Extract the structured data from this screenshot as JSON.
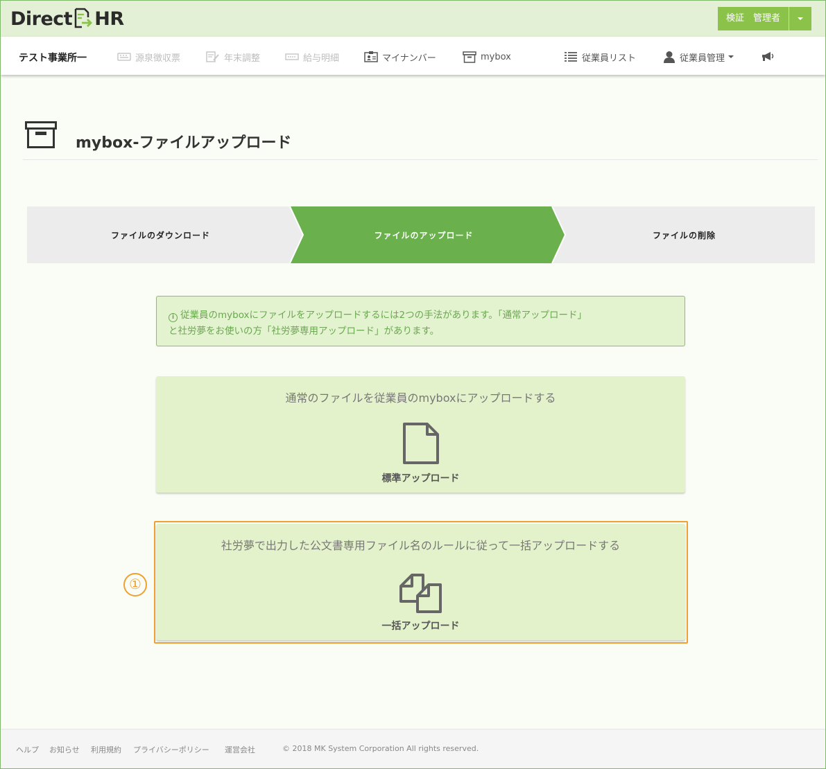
{
  "brand": {
    "name_left": "Direct",
    "name_right": "HR",
    "accent": "#8bc34a"
  },
  "user_menu": {
    "label": "検証　管理者"
  },
  "nav": {
    "office": "テスト事業所一",
    "items": [
      {
        "label": "源泉徴収票",
        "icon": "keyboard-icon",
        "enabled": false
      },
      {
        "label": "年末調整",
        "icon": "edit-document-icon",
        "enabled": false
      },
      {
        "label": "給与明細",
        "icon": "ticket-icon",
        "enabled": false
      },
      {
        "label": "マイナンバー",
        "icon": "id-card-icon",
        "enabled": true
      },
      {
        "label": "mybox",
        "icon": "archive-box-icon",
        "enabled": true
      },
      {
        "label": "従業員リスト",
        "icon": "list-icon",
        "enabled": true
      },
      {
        "label": "従業員管理",
        "icon": "user-icon",
        "enabled": true
      },
      {
        "label": "",
        "icon": "megaphone-icon",
        "enabled": true
      }
    ]
  },
  "page": {
    "title": "mybox-ファイルアップロード"
  },
  "steps": [
    {
      "label": "ファイルのダウンロード",
      "active": false
    },
    {
      "label": "ファイルのアップロード",
      "active": true
    },
    {
      "label": "ファイルの削除",
      "active": false
    }
  ],
  "info": {
    "line1": "従業員のmyboxにファイルをアップロードするには2つの手法があります。「通常アップロード」",
    "line2": "と社労夢をお使いの方「社労夢専用アップロード」があります。"
  },
  "panels": {
    "standard": {
      "title": "通常のファイルを従業員のmyboxにアップロードする",
      "label": "標準アップロード",
      "icon": "file-icon"
    },
    "bulk": {
      "title": "社労夢で出力した公文書専用ファイル名のルールに従って一括アップロードする",
      "label": "一括アップロード",
      "icon": "copy-files-icon"
    }
  },
  "annotation": {
    "marker": "①",
    "color": "#f0a030"
  },
  "footer": {
    "links": [
      "ヘルプ",
      "お知らせ",
      "利用規約",
      "プライバシーポリシー",
      "運営会社"
    ],
    "copyright": "© 2018 MK System Corporation All rights reserved."
  }
}
